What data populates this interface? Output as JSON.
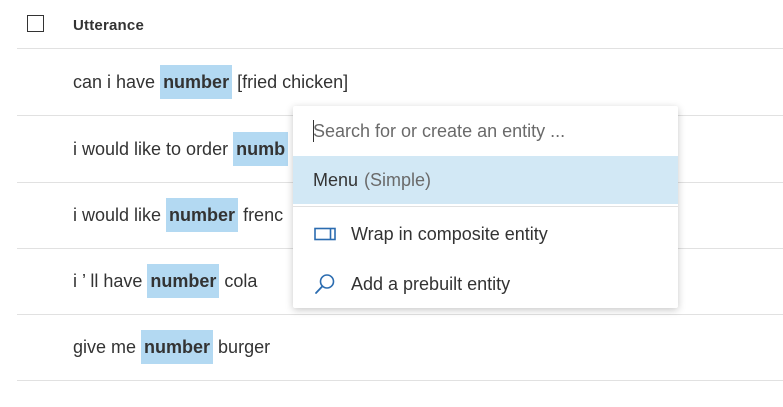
{
  "table": {
    "column_header": "Utterance",
    "rows": [
      {
        "before": "can i have",
        "entity": "number",
        "after": "[fried chicken]"
      },
      {
        "before": "i would like to order",
        "entity": "numb",
        "after": ""
      },
      {
        "before": "i would like",
        "entity": "number",
        "after": "frenc"
      },
      {
        "before": "i ’ ll have",
        "entity": "number",
        "after": "cola"
      },
      {
        "before": "give me",
        "entity": "number",
        "after": "burger"
      }
    ]
  },
  "entity_menu": {
    "search_placeholder": "Search for or create an entity ...",
    "search_value": "",
    "selected_item": {
      "name": "Menu",
      "type": "(Simple)"
    },
    "actions": [
      {
        "label": "Wrap in composite entity",
        "icon": "composite-entity-icon"
      },
      {
        "label": "Add a prebuilt entity",
        "icon": "search-icon"
      }
    ]
  },
  "colors": {
    "entity_highlight": "#b3d9f2",
    "selected_menu_item": "#d2e8f5",
    "icon_accent": "#2b6cb0",
    "divider": "#e1e1e1"
  }
}
